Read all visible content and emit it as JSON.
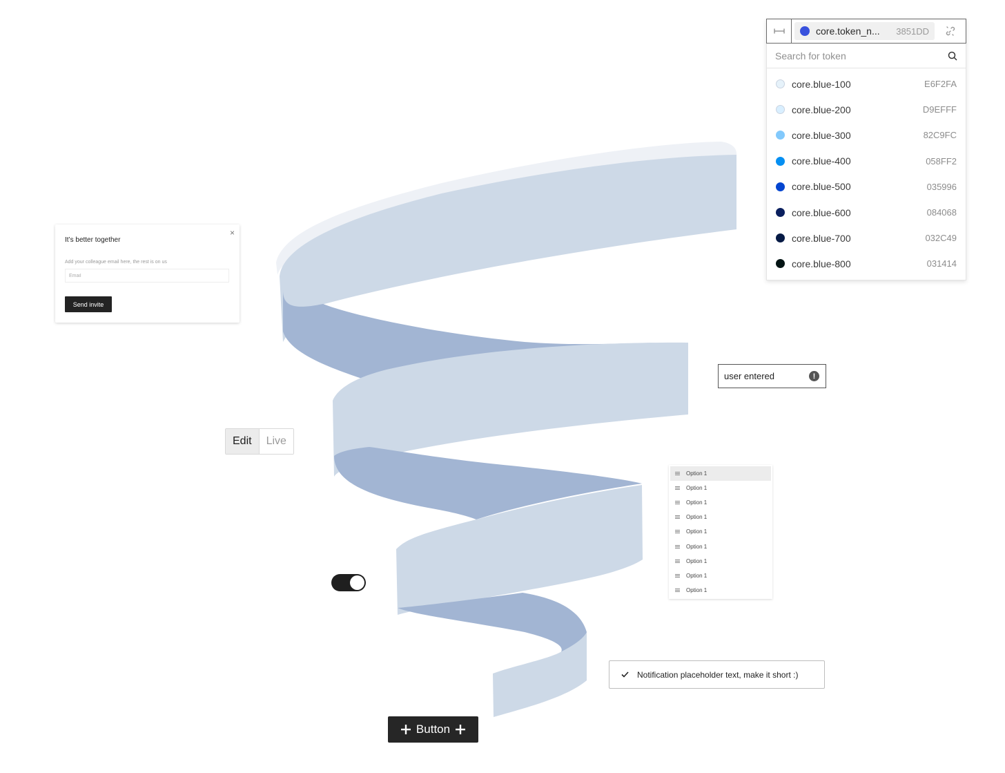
{
  "token_picker": {
    "selected": {
      "name": "core.token_n...",
      "hex": "3851DD",
      "color": "#3851DD"
    },
    "search_placeholder": "Search for token",
    "icons": {
      "width": "width-arrows-icon",
      "unlink": "unlink-icon",
      "search": "search-icon"
    },
    "tokens": [
      {
        "name": "core.blue-100",
        "hex": "E6F2FA",
        "color": "#E6F2FA"
      },
      {
        "name": "core.blue-200",
        "hex": "D9EFFF",
        "color": "#D9EFFF"
      },
      {
        "name": "core.blue-300",
        "hex": "82C9FC",
        "color": "#82C9FC"
      },
      {
        "name": "core.blue-400",
        "hex": "058FF2",
        "color": "#058FF2"
      },
      {
        "name": "core.blue-500",
        "hex": "035996",
        "color": "#0345D0"
      },
      {
        "name": "core.blue-600",
        "hex": "084068",
        "color": "#0A1F5E"
      },
      {
        "name": "core.blue-700",
        "hex": "032C49",
        "color": "#061A45"
      },
      {
        "name": "core.blue-800",
        "hex": "031414",
        "color": "#031414"
      }
    ]
  },
  "invite_modal": {
    "title": "It’s better together",
    "description": "Add your colleague email here, the rest is on us",
    "email_placeholder": "Email",
    "send_label": "Send invite",
    "close_glyph": "×"
  },
  "user_input": {
    "value": "user entered",
    "warning_glyph": "!"
  },
  "mode_toggle": {
    "options": [
      "Edit",
      "Live"
    ],
    "selected": "Edit"
  },
  "options_list": {
    "items": [
      "Option 1",
      "Option 1",
      "Option 1",
      "Option 1",
      "Option 1",
      "Option 1",
      "Option 1",
      "Option 1",
      "Option 1"
    ]
  },
  "switch": {
    "on": true
  },
  "notification": {
    "text": "Notification placeholder text, make it short :)",
    "check_glyph": "✓"
  },
  "primary_button": {
    "label": "Button",
    "icon_glyph": "+"
  },
  "colors": {
    "ribbon_light": "#CDD9E7",
    "ribbon_dark": "#A2B5D3",
    "ribbon_top": "#EEF1F6"
  }
}
